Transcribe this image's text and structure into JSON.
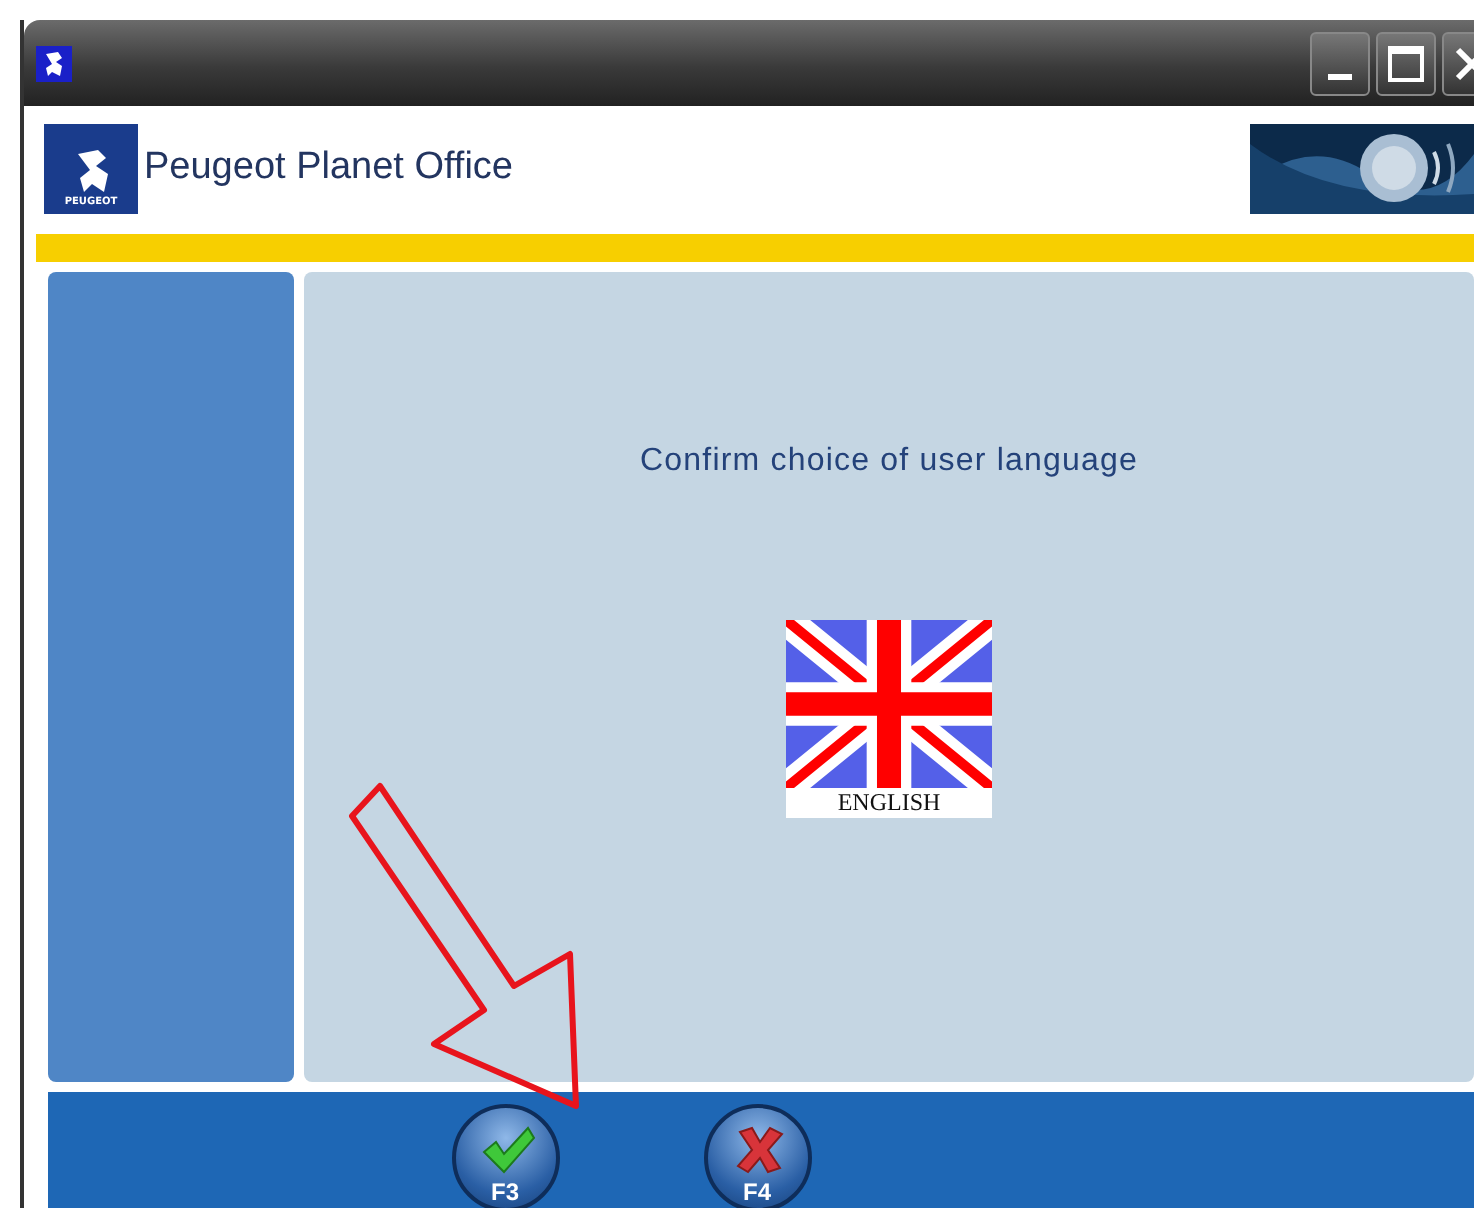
{
  "window": {
    "title_bar_buttons": [
      {
        "kind": "minimize"
      },
      {
        "kind": "maximize"
      },
      {
        "kind": "close"
      }
    ]
  },
  "header": {
    "logo_text": "PEUGEOT",
    "title": "Peugeot Planet Office"
  },
  "prompt": "Confirm choice of user language",
  "language": {
    "label": "ENGLISH"
  },
  "footer_buttons": [
    {
      "kind": "confirm",
      "key": "F3"
    },
    {
      "kind": "cancel",
      "key": "F4"
    }
  ],
  "annotation": {
    "kind": "arrow"
  }
}
